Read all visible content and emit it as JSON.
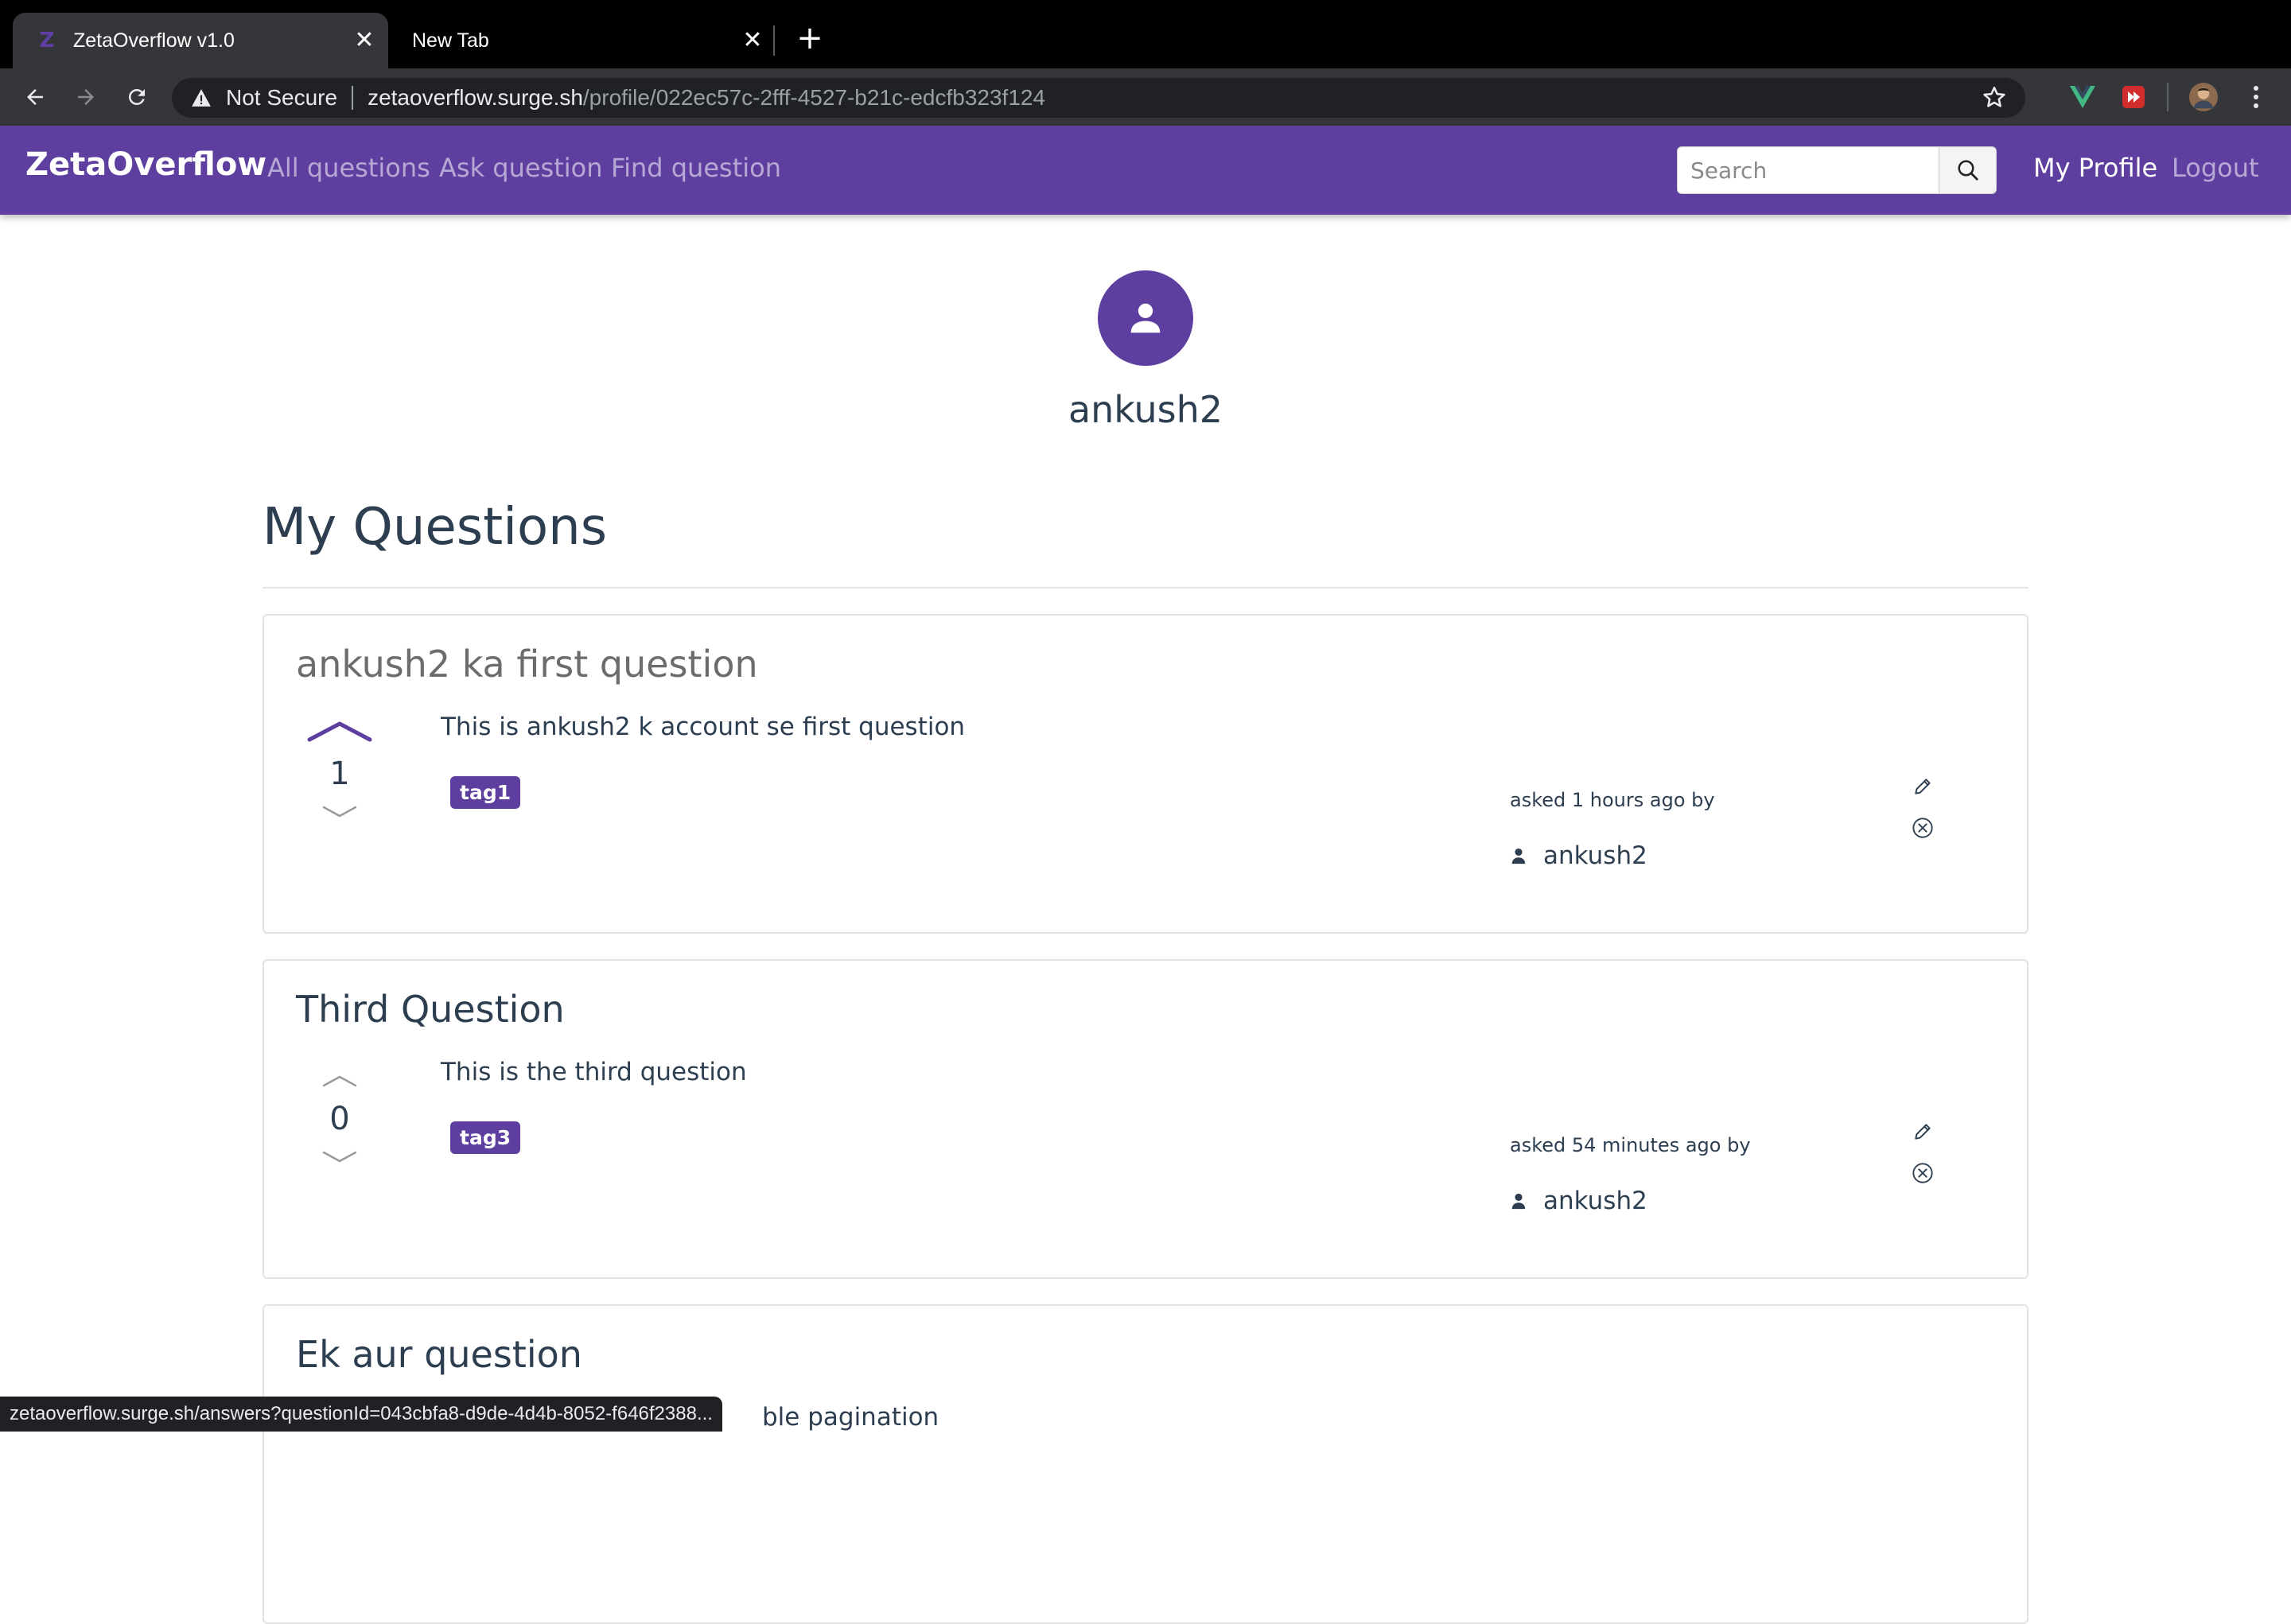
{
  "browser": {
    "tabs": [
      {
        "title": "ZetaOverflow v1.0",
        "active": true,
        "favicon": "Z"
      },
      {
        "title": "New Tab",
        "active": false
      }
    ],
    "close_glyph": "✕",
    "new_tab_glyph": "+",
    "security_label": "Not Secure",
    "url_host": "zetaoverflow.surge.sh",
    "url_path": "/profile/022ec57c-2fff-4527-b21c-edcfb323f124",
    "status_url": "zetaoverflow.surge.sh/answers?questionId=043cbfa8-d9de-4d4b-8052-f646f2388..."
  },
  "navbar": {
    "brand": "ZetaOverflow",
    "links": [
      "All questions",
      "Ask question",
      "Find question"
    ],
    "search_placeholder": "Search",
    "my_profile": "My Profile",
    "logout": "Logout",
    "colors": {
      "bar": "#5e3f9f",
      "active_link": "#ffffff",
      "inactive_link": "rgba(255,255,255,0.55)"
    }
  },
  "profile": {
    "username": "ankush2",
    "section_title": "My Questions"
  },
  "questions": [
    {
      "title": "ankush2 ka first question",
      "body": "This is ankush2 k account se first question",
      "votes": "1",
      "upvoted": true,
      "tag": "tag1",
      "asked": "asked 1 hours ago by",
      "author": "ankush2"
    },
    {
      "title": "Third Question",
      "body": "This is the third question",
      "votes": "0",
      "upvoted": false,
      "tag": "tag3",
      "asked": "asked 54 minutes ago by",
      "author": "ankush2"
    },
    {
      "title": "Ek aur question",
      "body_partial": "ble pagination"
    }
  ],
  "icons": {
    "back": "arrow-left-icon",
    "forward": "arrow-right-icon",
    "reload": "reload-icon",
    "warning": "warning-icon",
    "bookmark": "star-icon",
    "search": "search-icon",
    "avatar": "person-icon",
    "edit": "pencil-icon",
    "delete": "close-circle-icon",
    "menu": "kebab-menu-icon"
  }
}
